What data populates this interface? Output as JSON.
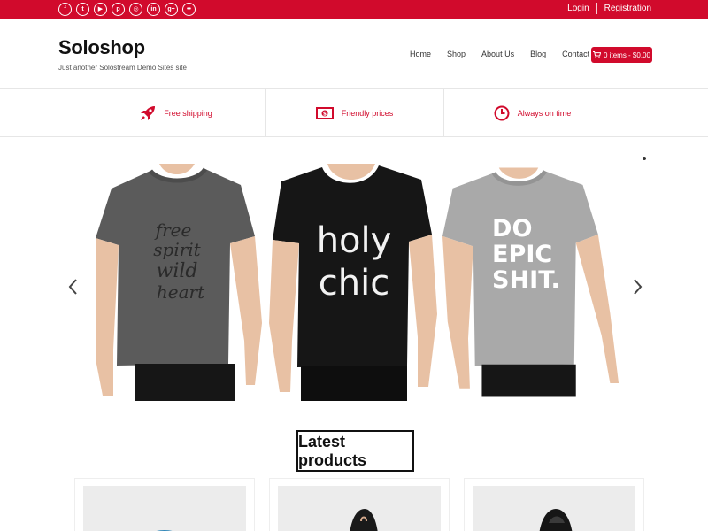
{
  "topbar": {
    "social_icons": [
      {
        "name": "facebook-icon",
        "glyph": "f"
      },
      {
        "name": "twitter-icon",
        "glyph": "t"
      },
      {
        "name": "youtube-icon",
        "glyph": "▶"
      },
      {
        "name": "pinterest-icon",
        "glyph": "p"
      },
      {
        "name": "instagram-icon",
        "glyph": "◎"
      },
      {
        "name": "linkedin-icon",
        "glyph": "in"
      },
      {
        "name": "google-plus-icon",
        "glyph": "g+"
      },
      {
        "name": "flickr-icon",
        "glyph": "••"
      }
    ],
    "login_label": "Login",
    "registration_label": "Registration"
  },
  "site": {
    "title": "Soloshop",
    "description": "Just another Solostream Demo Sites site"
  },
  "nav": {
    "items": [
      "Home",
      "Shop",
      "About Us",
      "Blog",
      "Contact Us"
    ],
    "cart_label": "0 items - $0.00"
  },
  "features": [
    {
      "icon": "rocket-icon",
      "label": "Free shipping"
    },
    {
      "icon": "money-icon",
      "label": "Friendly prices"
    },
    {
      "icon": "clock-icon",
      "label": "Always on time"
    }
  ],
  "slider": {
    "shirts": [
      {
        "name": "grey-shirt",
        "color": "#5b5b5b",
        "print": [
          "free",
          "spirit",
          "wild",
          "heart"
        ],
        "print_color": "#2a2a2a"
      },
      {
        "name": "black-shirt",
        "color": "#161616",
        "print": [
          "holy",
          "chic"
        ],
        "print_color": "#f2f2f2"
      },
      {
        "name": "lightgrey-shirt",
        "color": "#a9a9a9",
        "print": [
          "DO",
          "EPIC",
          "SHIT."
        ],
        "print_color": "#ffffff"
      }
    ]
  },
  "latest_products": {
    "title": "Latest products"
  },
  "colors": {
    "brand": "#d10a2c"
  }
}
